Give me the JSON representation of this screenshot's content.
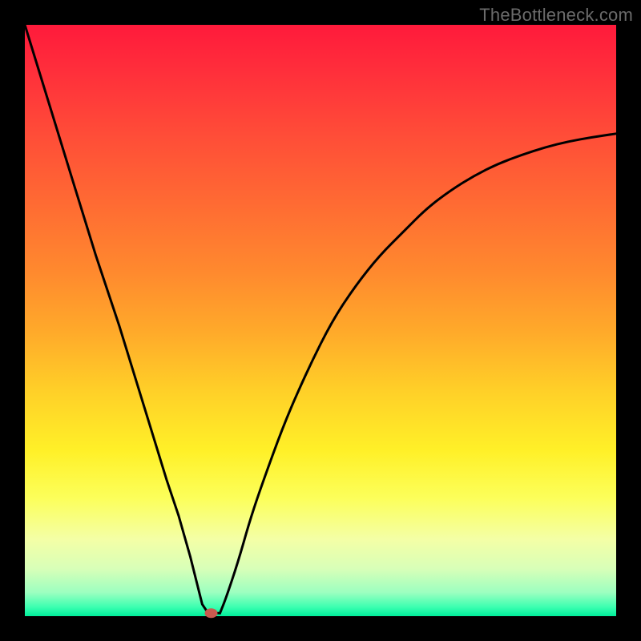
{
  "watermark": {
    "text": "TheBottleneck.com"
  },
  "chart_data": {
    "type": "line",
    "title": "",
    "xlabel": "",
    "ylabel": "",
    "xlim": [
      0,
      100
    ],
    "ylim": [
      0,
      100
    ],
    "grid": false,
    "legend": false,
    "series": [
      {
        "name": "curve",
        "x": [
          0,
          4,
          8,
          12,
          16,
          20,
          24,
          26,
          28,
          29,
          30,
          31,
          32,
          33,
          34,
          36,
          38,
          40,
          44,
          48,
          52,
          56,
          60,
          64,
          68,
          72,
          76,
          80,
          84,
          88,
          92,
          96,
          100
        ],
        "y": [
          100,
          87,
          74,
          61,
          49,
          36,
          23,
          17,
          10,
          6,
          2,
          0.5,
          0.5,
          0.5,
          3,
          9,
          16,
          22,
          33,
          42,
          50,
          56,
          61,
          65,
          69,
          72,
          74.5,
          76.5,
          78,
          79.3,
          80.3,
          81,
          81.6
        ]
      }
    ],
    "marker": {
      "x_frac": 0.315,
      "y_frac": 0.005,
      "color": "#c95a4f",
      "rx": 8,
      "ry": 6
    },
    "curve_color": "#000000",
    "curve_width": 3
  }
}
